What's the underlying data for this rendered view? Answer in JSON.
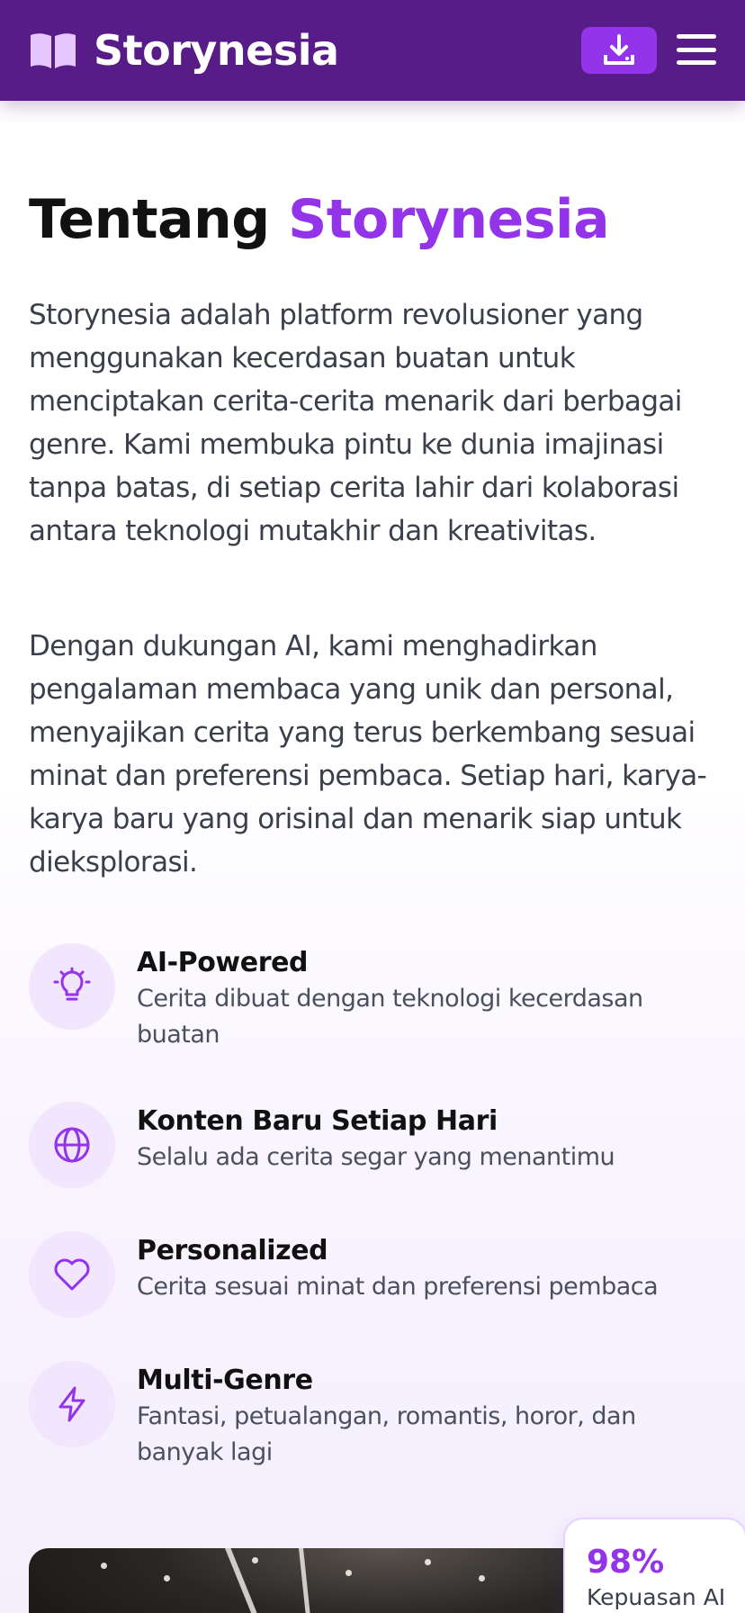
{
  "header": {
    "brand": "Storynesia",
    "logo_icon": "open-book-icon",
    "download_icon": "download-icon",
    "menu_icon": "hamburger-menu-icon"
  },
  "about": {
    "title_prefix": "Tentang",
    "title_accent": "Storynesia",
    "paragraphs": [
      "Storynesia adalah platform revolusioner yang menggunakan kecerdasan buatan untuk menciptakan cerita-cerita menarik dari berbagai genre. Kami membuka pintu ke dunia imajinasi tanpa batas, di setiap cerita lahir dari kolaborasi antara teknologi mutakhir dan kreativitas.",
      "Dengan dukungan AI, kami menghadirkan pengalaman membaca yang unik dan personal, menyajikan cerita yang terus berkembang sesuai minat dan preferensi pembaca. Setiap hari, karya-karya baru yang orisinal dan menarik siap untuk dieksplorasi."
    ]
  },
  "features": [
    {
      "icon": "lightbulb-icon",
      "title": "AI-Powered",
      "desc": "Cerita dibuat dengan teknologi kecerdasan buatan"
    },
    {
      "icon": "globe-icon",
      "title": "Konten Baru Setiap Hari",
      "desc": "Selalu ada cerita segar yang menantimu"
    },
    {
      "icon": "heart-icon",
      "title": "Personalized",
      "desc": "Cerita sesuai minat dan preferensi pembaca"
    },
    {
      "icon": "lightning-icon",
      "title": "Multi-Genre",
      "desc": "Fantasi, petualangan, romantis, horor, dan banyak lagi"
    }
  ],
  "stat": {
    "value": "98%",
    "label": "Kepuasan AI"
  },
  "colors": {
    "header_bg": "#571c88",
    "accent": "#9333ea",
    "icon_bg": "#f1e6fd"
  }
}
